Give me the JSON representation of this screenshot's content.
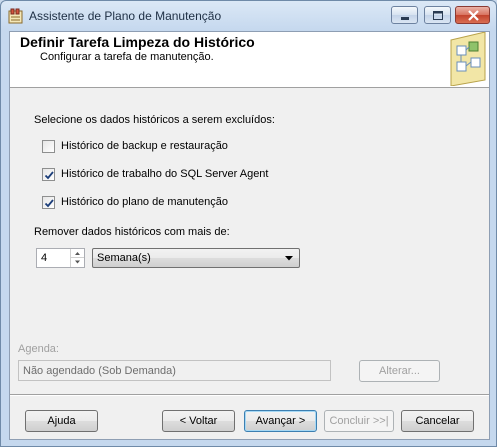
{
  "window": {
    "title": "Assistente de Plano de Manutenção",
    "icon": "wizard-app-icon"
  },
  "header": {
    "title": "Definir Tarefa Limpeza do Histórico",
    "subtitle": "Configurar a tarefa de manutenção."
  },
  "main": {
    "select_label": "Selecione os dados históricos a serem excluídos:",
    "options": [
      {
        "label": "Histórico de backup e restauração",
        "checked": false
      },
      {
        "label": "Histórico de trabalho do SQL Server Agent",
        "checked": true
      },
      {
        "label": "Histórico do plano de manutenção",
        "checked": true
      }
    ],
    "remove_label": "Remover dados históricos com mais de:",
    "age_value": "4",
    "age_unit": "Semana(s)"
  },
  "schedule": {
    "label": "Agenda:",
    "value": "Não agendado (Sob Demanda)",
    "change_button": "Alterar..."
  },
  "footer": {
    "help": "Ajuda",
    "back": "< Voltar",
    "next": "Avançar >",
    "finish": "Concluir >>|",
    "cancel": "Cancelar"
  },
  "colors": {
    "title_bar": "#c5d8ee",
    "close_button": "#c2432d",
    "default_button_border": "#3c7fb1",
    "disabled_text": "#a0a0a0"
  }
}
